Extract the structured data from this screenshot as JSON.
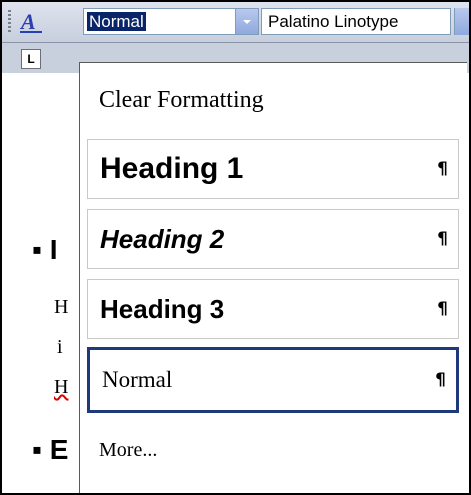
{
  "toolbar": {
    "style_value": "Normal",
    "font_value": "Palatino Linotype"
  },
  "ruler": {
    "tab_selector": "L"
  },
  "document": {
    "heading_bullet_1": "▪ I",
    "body_lines": [
      "H",
      "i",
      "H"
    ],
    "heading_bullet_2": "▪ E"
  },
  "dropdown": {
    "clear_formatting": "Clear Formatting",
    "items": [
      {
        "label": "Heading 1",
        "mark": "¶"
      },
      {
        "label": "Heading 2",
        "mark": "¶"
      },
      {
        "label": "Heading 3",
        "mark": "¶"
      },
      {
        "label": "Normal",
        "mark": "¶"
      }
    ],
    "more": "More..."
  },
  "icons": {
    "styles": "styles-and-formatting-icon",
    "dropdown": "chevron-down-icon"
  },
  "colors": {
    "selection": "#0a246a",
    "selected_border": "#1f3a7a",
    "toolbar_bg": "#c7cedd"
  }
}
